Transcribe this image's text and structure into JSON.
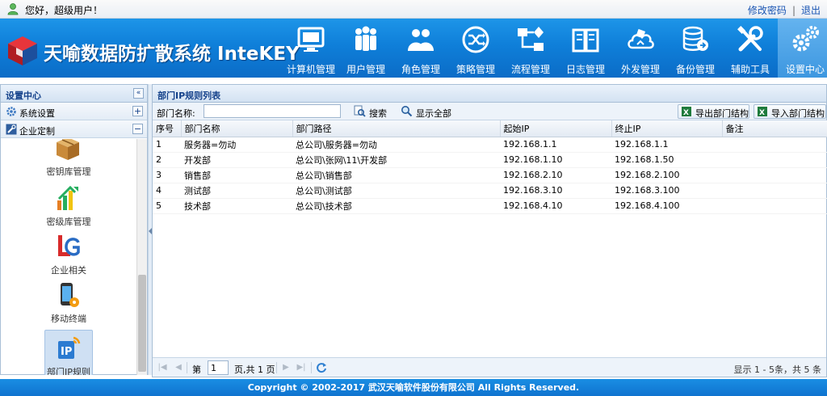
{
  "topbar": {
    "greeting": "您好，超级用户！",
    "change_password": "修改密码",
    "separator": "|",
    "logout": "退出"
  },
  "header": {
    "logo_text": "天喻数据防扩散系统 InteKEY",
    "nav": [
      {
        "label": "计算机管理",
        "icon": "monitor-icon"
      },
      {
        "label": "用户管理",
        "icon": "users-icon"
      },
      {
        "label": "角色管理",
        "icon": "roles-icon"
      },
      {
        "label": "策略管理",
        "icon": "shuffle-icon"
      },
      {
        "label": "流程管理",
        "icon": "flow-icon"
      },
      {
        "label": "日志管理",
        "icon": "book-icon"
      },
      {
        "label": "外发管理",
        "icon": "cloud-icon"
      },
      {
        "label": "备份管理",
        "icon": "database-icon"
      },
      {
        "label": "辅助工具",
        "icon": "tools-icon"
      },
      {
        "label": "设置中心",
        "icon": "gears-icon",
        "active": true
      }
    ]
  },
  "left_panel": {
    "title": "设置中心",
    "collapse_glyph": "«",
    "sections": [
      {
        "label": "系统设置",
        "toggle": "+"
      },
      {
        "label": "企业定制",
        "toggle": "−"
      }
    ],
    "modules": [
      {
        "label": "密钥库管理",
        "icon": "box-icon"
      },
      {
        "label": "密级库管理",
        "icon": "level-bars-icon"
      },
      {
        "label": "企业相关",
        "icon": "lg-logo-icon"
      },
      {
        "label": "移动终端",
        "icon": "mobile-icon"
      },
      {
        "label": "部门IP规则",
        "icon": "ip-rule-icon",
        "selected": true
      }
    ]
  },
  "right_panel": {
    "title": "部门IP规则列表",
    "toolbar": {
      "dept_label": "部门名称:",
      "dept_value": "",
      "search": "搜索",
      "show_all": "显示全部",
      "export": "导出部门结构",
      "import": "导入部门结构"
    },
    "columns": [
      "序号",
      "部门名称",
      "部门路径",
      "起始IP",
      "终止IP",
      "备注"
    ],
    "rows": [
      [
        "1",
        "服务器=勿动",
        "总公司\\服务器=勿动",
        "192.168.1.1",
        "192.168.1.1",
        ""
      ],
      [
        "2",
        "开发部",
        "总公司\\张网\\11\\开发部",
        "192.168.1.10",
        "192.168.1.50",
        ""
      ],
      [
        "3",
        "销售部",
        "总公司\\销售部",
        "192.168.2.10",
        "192.168.2.100",
        ""
      ],
      [
        "4",
        "测试部",
        "总公司\\测试部",
        "192.168.3.10",
        "192.168.3.100",
        ""
      ],
      [
        "5",
        "技术部",
        "总公司\\技术部",
        "192.168.4.10",
        "192.168.4.100",
        ""
      ]
    ],
    "pager": {
      "page_prefix": "第",
      "page_value": "1",
      "page_suffix": "页,共 1 页",
      "summary": "显示 1 - 5条，共 5 条"
    }
  },
  "footer": {
    "copyright": "Copyright © 2002-2017 武汉天喻软件股份有限公司 All Rights Reserved."
  },
  "colors": {
    "header_blue": "#0f7fd9",
    "panel_title": "#15428b",
    "link_blue": "#1a55b3"
  }
}
